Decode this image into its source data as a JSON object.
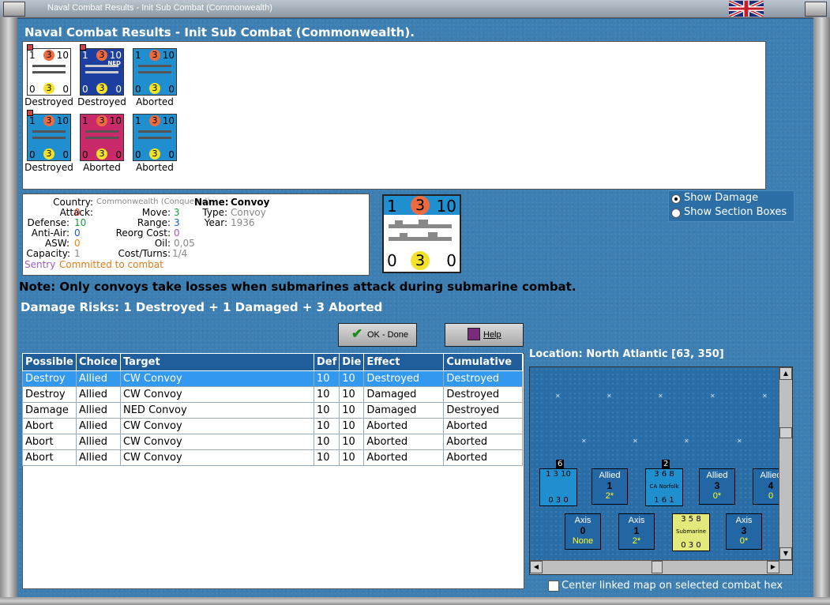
{
  "window": {
    "title": "Naval Combat Results - Init Sub Combat (Commonwealth)"
  },
  "header": "Naval Combat Results - Init Sub Combat (Commonwealth).",
  "units": [
    {
      "top": "1",
      "mid": "3",
      "right": "10",
      "bl": "0",
      "bc": "3",
      "br": "0",
      "status": "Destroyed",
      "color": "#ffffff",
      "tag": ""
    },
    {
      "top": "1",
      "mid": "3",
      "right": "10",
      "bl": "0",
      "bc": "3",
      "br": "0",
      "status": "Destroyed",
      "color": "#1d3fa0",
      "tag": "NED"
    },
    {
      "top": "1",
      "mid": "3",
      "right": "10",
      "bl": "0",
      "bc": "3",
      "br": "0",
      "status": "Aborted",
      "color": "#1f8fd0",
      "tag": ""
    },
    {
      "top": "1",
      "mid": "3",
      "right": "10",
      "bl": "0",
      "bc": "3",
      "br": "0",
      "status": "Destroyed",
      "color": "#1f8fd0",
      "tag": ""
    },
    {
      "top": "1",
      "mid": "3",
      "right": "10",
      "bl": "0",
      "bc": "3",
      "br": "0",
      "status": "Aborted",
      "color": "#c92a6a",
      "tag": ""
    },
    {
      "top": "1",
      "mid": "3",
      "right": "10",
      "bl": "0",
      "bc": "3",
      "br": "0",
      "status": "Aborted",
      "color": "#1f8fd0",
      "tag": ""
    }
  ],
  "info": {
    "country_label": "Country:",
    "country": "Commonwealth (Conquered)",
    "attack_label": "Attack:",
    "attack": "0",
    "defense_label": "Defense:",
    "defense": "10",
    "antiair_label": "Anti-Air:",
    "antiair": "0",
    "asw_label": "ASW:",
    "asw": "0",
    "capacity_label": "Capacity:",
    "capacity": "1",
    "sentry_label": "Sentry",
    "sentry": "Committed to combat",
    "name_label": "Name:",
    "name": "Convoy",
    "type_label": "Type:",
    "type": "Convoy",
    "year_label": "Year:",
    "year": "1936",
    "move_label": "Move:",
    "move": "3",
    "range_label": "Range:",
    "range": "3",
    "reorg_label": "Reorg Cost:",
    "reorg": "0",
    "oil_label": "Oil:",
    "oil": "0,05",
    "cost_label": "Cost/Turns:",
    "cost": "1/4"
  },
  "big_counter": {
    "top": "1",
    "mid": "3",
    "right": "10",
    "bl": "0",
    "bc": "3",
    "br": "0"
  },
  "options": {
    "show_damage": "Show Damage",
    "show_section": "Show Section Boxes"
  },
  "note": "Note: Only convoys take losses when submarines attack during submarine combat.",
  "damage_risks": "Damage Risks: 1 Destroyed + 1 Damaged + 3 Aborted",
  "buttons": {
    "ok": "OK - Done",
    "help": "Help"
  },
  "table": {
    "headers": [
      "Possible",
      "Choice",
      "Target",
      "Def",
      "Die",
      "Effect",
      "Cumulative"
    ],
    "rows": [
      [
        "Destroy",
        "Allied",
        "CW Convoy",
        "10",
        "10",
        "Destroyed",
        "Destroyed"
      ],
      [
        "Destroy",
        "Allied",
        "CW Convoy",
        "10",
        "10",
        "Damaged",
        "Destroyed"
      ],
      [
        "Damage",
        "Allied",
        "NED Convoy",
        "10",
        "10",
        "Damaged",
        "Destroyed"
      ],
      [
        "Abort",
        "Allied",
        "CW Convoy",
        "10",
        "10",
        "Aborted",
        "Aborted"
      ],
      [
        "Abort",
        "Allied",
        "CW Convoy",
        "10",
        "10",
        "Aborted",
        "Aborted"
      ],
      [
        "Abort",
        "Allied",
        "CW Convoy",
        "10",
        "10",
        "Aborted",
        "Aborted"
      ]
    ]
  },
  "location": "Location:  North Atlantic [63, 350]",
  "map": {
    "allied_boxes": [
      {
        "label": "Allied",
        "num": "1",
        "val": "2*"
      },
      {
        "label": "Allied",
        "num": "3",
        "val": "0*"
      },
      {
        "label": "Allied",
        "num": "4",
        "val": "0"
      }
    ],
    "axis_boxes": [
      {
        "label": "Axis",
        "num": "0",
        "val": "None"
      },
      {
        "label": "Axis",
        "num": "1",
        "val": "2*"
      },
      {
        "label": "Axis",
        "num": "3",
        "val": "0*"
      }
    ],
    "stack1": {
      "badge": "6",
      "top": "1 3 10",
      "bot": "0 3 0"
    },
    "stack2": {
      "badge": "2",
      "top": "3 6 8",
      "mid": "CA Norfolk",
      "bot": "1 6 1"
    },
    "sub": {
      "top": "3 5 8",
      "mid": "Submarine",
      "bot": "0 3 0"
    }
  },
  "center_label": "Center linked map on selected combat hex"
}
